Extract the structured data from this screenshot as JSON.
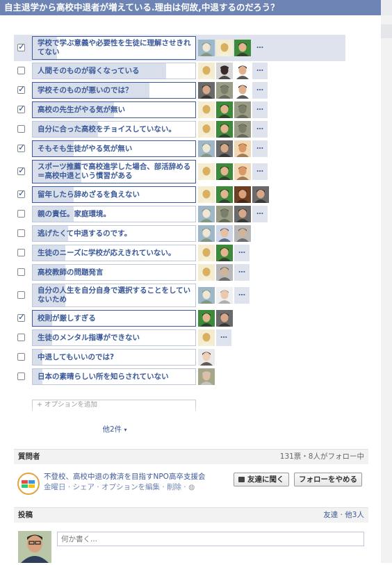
{
  "title": "自主退学から高校中退者が増えている.理由は何故,中退するのだろう？",
  "options": [
    {
      "label": "学校で学ぶ意義や必要性を生徒に理解させきれてない",
      "checked": true,
      "fill": 0.15,
      "faces": [
        "tower",
        "pale",
        "green"
      ],
      "more": true,
      "highlight": true,
      "tall": true
    },
    {
      "label": "人間そのものが弱くなっている",
      "checked": false,
      "fill": 0.82,
      "faces": [
        "pale",
        "dark",
        "red"
      ],
      "more": true
    },
    {
      "label": "学校そのものが悪いのでは？",
      "checked": true,
      "fill": 0.72,
      "faces": [
        "man",
        "bike",
        "red"
      ],
      "more": true
    },
    {
      "label": "高校の先生がやる気が無い",
      "checked": true,
      "fill": 0.5,
      "faces": [
        "pale",
        "green",
        "bike"
      ],
      "more": true
    },
    {
      "label": "自分に合った高校をチョイスしていない。",
      "checked": false,
      "fill": 0.4,
      "faces": [
        "pale",
        "green",
        "bike"
      ],
      "more": true
    },
    {
      "label": "そもそも生徒がやる気が無い",
      "checked": true,
      "fill": 0.25,
      "faces": [
        "tower",
        "man",
        "orange"
      ],
      "more": true
    },
    {
      "label": "スポーツ推薦で高校進学した場合、部活辞める＝高校中退という慣習がある",
      "checked": true,
      "fill": 0.3,
      "faces": [
        "pale",
        "green",
        "orange"
      ],
      "more": true,
      "tall": true
    },
    {
      "label": "留年したら辞めざるを負えない",
      "checked": true,
      "fill": 0.25,
      "faces": [
        "pale",
        "green",
        "brown",
        "man"
      ],
      "more": false
    },
    {
      "label": "親の責任。家庭環境。",
      "checked": false,
      "fill": 0.25,
      "faces": [
        "tower",
        "bike",
        "man"
      ],
      "more": true
    },
    {
      "label": "逃げたくて中退するのです。",
      "checked": false,
      "fill": 0.22,
      "faces": [
        "tower",
        "blue",
        "gray"
      ],
      "more": false
    },
    {
      "label": "生徒のニーズに学校が応えきれていない。",
      "checked": false,
      "fill": 0.2,
      "faces": [
        "pale",
        "green"
      ],
      "more": true
    },
    {
      "label": "高校教師の問題発言",
      "checked": false,
      "fill": 0.2,
      "faces": [
        "pale",
        "gray"
      ],
      "more": true
    },
    {
      "label": "自分の人生を自分自身で選択することをしていないため",
      "checked": false,
      "fill": 0.2,
      "faces": [
        "tower",
        "light"
      ],
      "more": true,
      "tall": true
    },
    {
      "label": "校則が厳しすぎる",
      "checked": true,
      "fill": 0.12,
      "faces": [
        "green",
        "man"
      ],
      "more": false
    },
    {
      "label": "生徒のメンタル指導ができない",
      "checked": false,
      "fill": 0.12,
      "faces": [
        "pale"
      ],
      "more": true
    },
    {
      "label": "中退してもいいのでは?",
      "checked": false,
      "fill": 0.06,
      "faces": [
        "woman"
      ],
      "more": false
    },
    {
      "label": "日本の素晴らしい所を知らされていない",
      "checked": false,
      "fill": 0.06,
      "faces": [
        "old"
      ],
      "more": false
    }
  ],
  "more_label": "…",
  "add_option_placeholder": "+ オプションを追加",
  "others_link": "他2件",
  "chevron_glyph": "▾",
  "asker": {
    "header": "質問者",
    "stats": "131票・8人がフォロー中",
    "name": "不登校、高校中退の救済を目指すNPO高卒支援会",
    "meta_links": "金曜日 · シェア · オプションを編集 · 削除 ·",
    "ask_friends": "友達に聞く",
    "unfollow": "フォローをやめる"
  },
  "post": {
    "header": "投稿",
    "audience": "友達 · 他3人",
    "placeholder": "何か書く..."
  },
  "colors": {
    "accent": "#3b5998",
    "titlebar": "#6d84b4",
    "fill": "#d8dfea"
  }
}
